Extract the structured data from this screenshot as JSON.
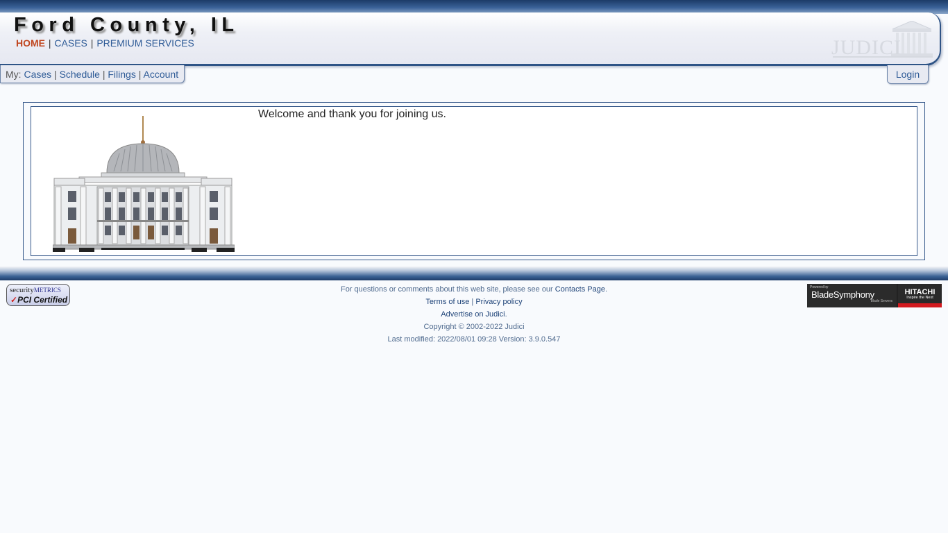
{
  "header": {
    "site_title": "Ford County, IL",
    "nav": {
      "home": "HOME",
      "cases": "CASES",
      "premium": "PREMIUM SERVICES",
      "separator": "|"
    },
    "logo_text": "JUDICI"
  },
  "subnav": {
    "prefix": "My:",
    "items": [
      "Cases",
      "Schedule",
      "Filings",
      "Account"
    ],
    "login": "Login"
  },
  "content": {
    "welcome": "Welcome and thank you for joining us.",
    "image": "courthouse"
  },
  "footer": {
    "contact_text": "For questions or comments about this web site, please see our",
    "contact_link": "Contacts Page",
    "terms": "Terms of use",
    "privacy": "Privacy policy",
    "advertise": "Advertise on Judici",
    "copyright": "Copyright © 2002-2022 Judici",
    "last_modified": "Last modified: 2022/08/01 09:28 Version: 3.9.0.547",
    "pci_badge": {
      "line1a": "security",
      "line1b": "METRICS",
      "check": "✓",
      "line2": "PCI Certified"
    },
    "blade_badge": {
      "powered": "Powered by",
      "name": "BladeSymphony",
      "sub": "Blade Servers",
      "brand": "HITACHI",
      "tagline": "Inspire the Next"
    }
  },
  "colors": {
    "nav_active": "#c0461f",
    "link": "#2d5a96",
    "border": "#35588a"
  }
}
